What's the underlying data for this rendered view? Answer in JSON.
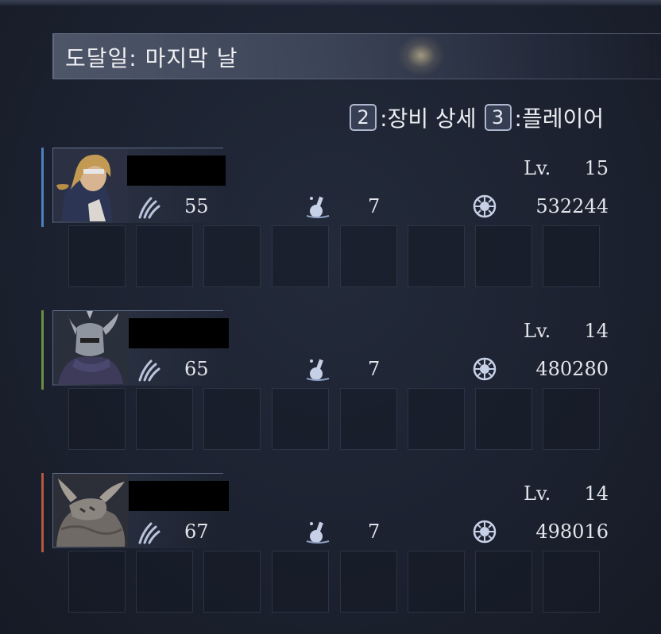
{
  "title": "도달일: 마지막 날",
  "hints": [
    {
      "key": "2",
      "label": ":장비 상세"
    },
    {
      "key": "3",
      "label": ":플레이어"
    }
  ],
  "colors": {
    "accent_player1": "#4d7fc4",
    "accent_player2": "#6c8f45",
    "accent_player3": "#b5583e"
  },
  "icons": {
    "stat1": "claw-marks-icon",
    "stat2": "flask-icon",
    "stat3": "rune-sun-icon"
  },
  "players": [
    {
      "level_label": "Lv.",
      "level": "15",
      "stat1": "55",
      "stat2": "7",
      "stat3": "532244",
      "portrait": "hooded-woman-portrait"
    },
    {
      "level_label": "Lv.",
      "level": "14",
      "stat1": "65",
      "stat2": "7",
      "stat3": "480280",
      "portrait": "winged-helm-knight-portrait"
    },
    {
      "level_label": "Lv.",
      "level": "14",
      "stat1": "67",
      "stat2": "7",
      "stat3": "498016",
      "portrait": "horned-beast-portrait"
    }
  ],
  "equipment_slots_per_player": 8
}
